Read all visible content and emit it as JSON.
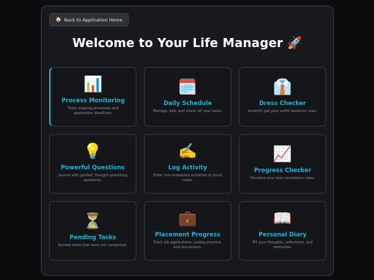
{
  "back_button": {
    "label": "Back to Application Home",
    "icon": "house-icon"
  },
  "page_title": "Welcome to Your Life Manager 🚀",
  "colors": {
    "accent": "#26b3d1",
    "background": "#0b0c0e",
    "panel": "#17191d"
  },
  "cards": [
    {
      "key": "process-monitoring",
      "icon": "📊",
      "title": "Process Monitoring",
      "desc": "Track ongoing processes and application deadlines."
    },
    {
      "key": "daily-schedule",
      "icon": "🗓️",
      "title": "Daily Schedule",
      "desc": "Manage, add, and check off your tasks."
    },
    {
      "key": "dress-checker",
      "icon": "👔",
      "title": "Dress Checker",
      "desc": "Instantly get your outfit based on rules."
    },
    {
      "key": "powerful-questions",
      "icon": "💡",
      "title": "Powerful Questions",
      "desc": "Journal with guided, thought-provoking questions."
    },
    {
      "key": "log-activity",
      "icon": "✍️",
      "title": "Log Activity",
      "desc": "Enter non-scheduled activities or quick notes."
    },
    {
      "key": "progress-checker",
      "icon": "📈",
      "title": "Progress Checker",
      "desc": "Visualize your task completion rates."
    },
    {
      "key": "pending-tasks",
      "icon": "⏳",
      "title": "Pending Tasks",
      "desc": "Review tasks that were not completed."
    },
    {
      "key": "placement-progress",
      "icon": "💼",
      "title": "Placement Progress",
      "desc": "Track job applications, coding practice, and documents."
    },
    {
      "key": "personal-diary",
      "icon": "📖",
      "title": "Personal Diary",
      "desc": "Fill your thoughts, reflections, and memories."
    }
  ]
}
